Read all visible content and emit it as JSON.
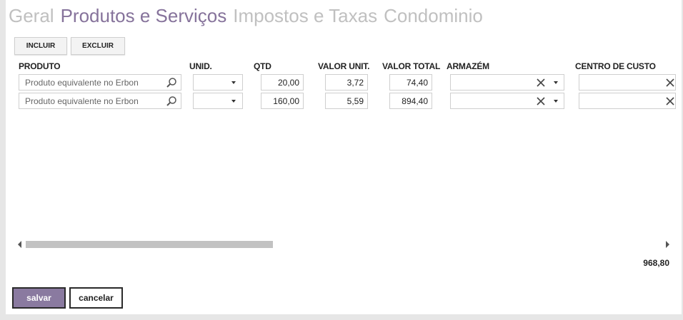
{
  "tabs": [
    {
      "label": "Geral"
    },
    {
      "label": "Produtos e Serviços"
    },
    {
      "label": "Impostos e Taxas"
    },
    {
      "label": "Condominio"
    }
  ],
  "toolbar": {
    "incluir_label": "INCLUIR",
    "excluir_label": "EXCLUIR"
  },
  "table": {
    "headers": {
      "produto": "PRODUTO",
      "unid": "UNID.",
      "qtd": "QTD",
      "valor_unit": "VALOR UNIT.",
      "valor_total": "VALOR TOTAL",
      "armazem": "ARMAZÉM",
      "centro_custo": "CENTRO DE CUSTO"
    },
    "rows": [
      {
        "produto_placeholder": "Produto equivalente no Erbon",
        "unid": "",
        "qtd": "20,00",
        "valor_unit": "3,72",
        "valor_total": "74,40",
        "armazem": "",
        "centro_custo": ""
      },
      {
        "produto_placeholder": "Produto equivalente no Erbon",
        "unid": "",
        "qtd": "160,00",
        "valor_unit": "5,59",
        "valor_total": "894,40",
        "armazem": "",
        "centro_custo": ""
      }
    ],
    "scroll_fraction_visible": 0.36
  },
  "footer": {
    "total": "968,80"
  },
  "actions": {
    "save_label": "salvar",
    "cancel_label": "cancelar"
  },
  "colors": {
    "accent": "#8a7aa0",
    "tab_active": "#86739b",
    "tab_inactive": "#c0c0c0"
  },
  "icons": {
    "search": "search-icon",
    "clear": "clear-icon",
    "dropdown": "chevron-down-icon"
  }
}
